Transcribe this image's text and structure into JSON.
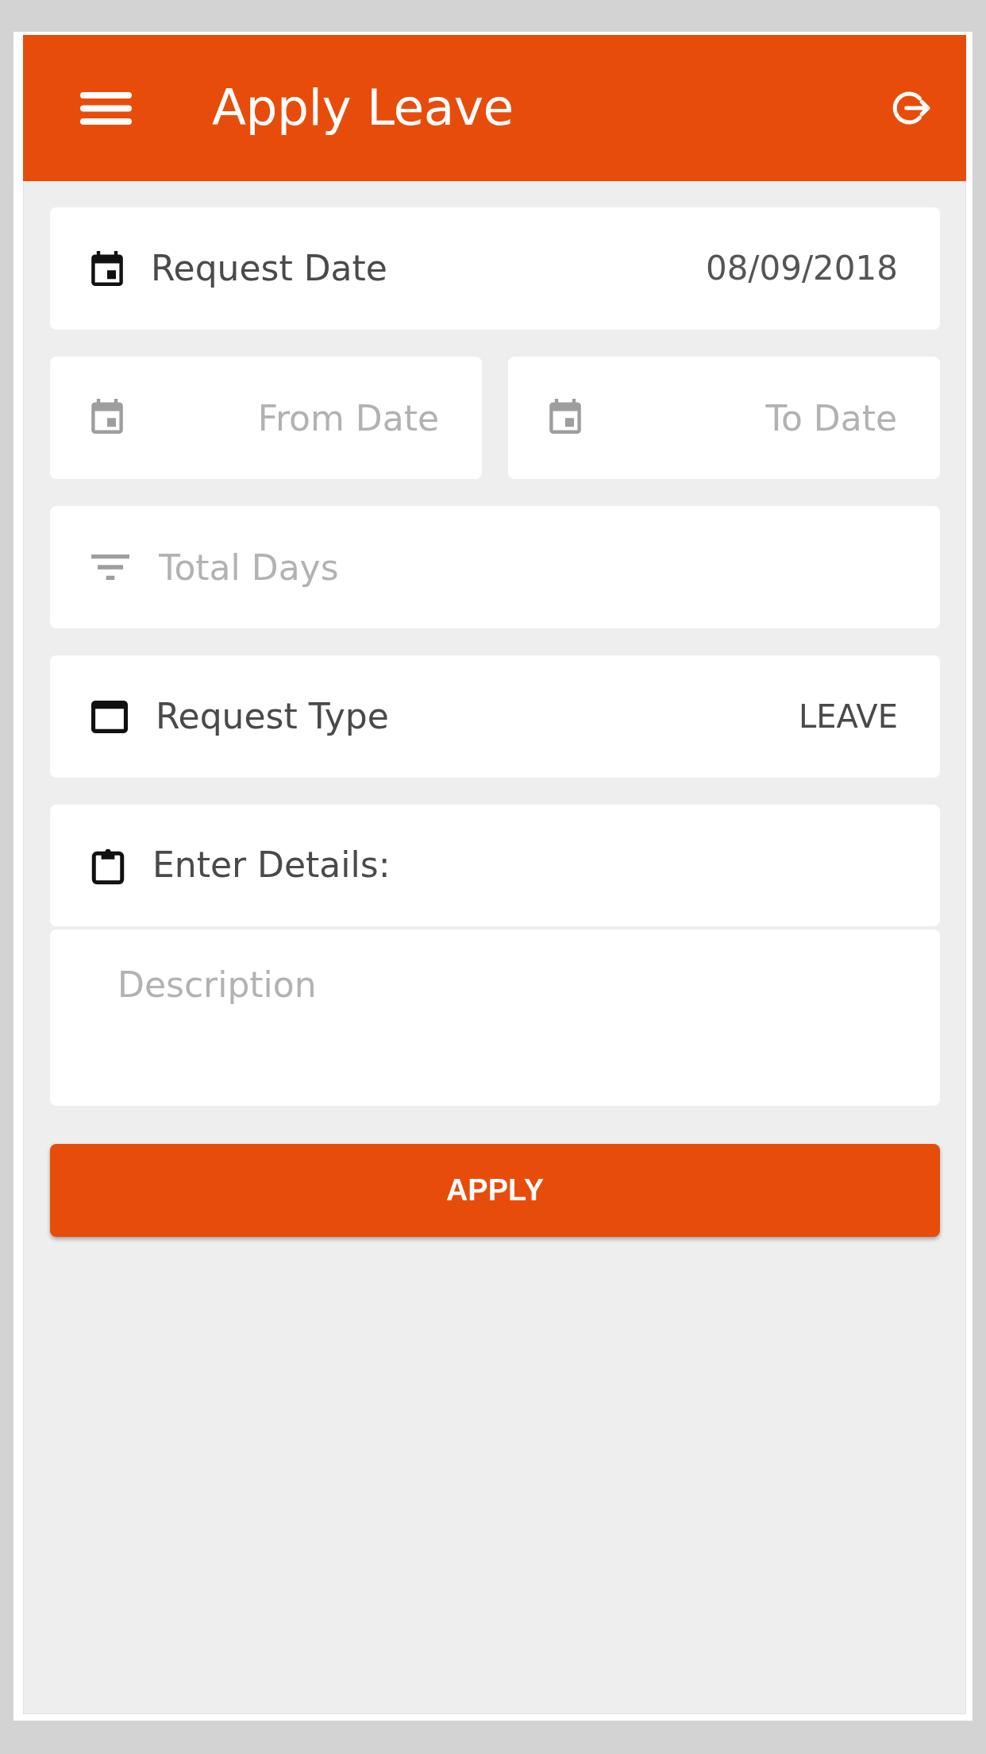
{
  "app_bar": {
    "title": "Apply Leave"
  },
  "request_date": {
    "label": "Request Date",
    "value": "08/09/2018"
  },
  "date_range": [
    {
      "placeholder": "From Date"
    },
    {
      "placeholder": "To Date"
    }
  ],
  "total_days": {
    "placeholder": "Total Days"
  },
  "request_type": {
    "label": "Request Type",
    "value": "LEAVE"
  },
  "details": {
    "label": "Enter Details:",
    "placeholder": "Description"
  },
  "apply_button": {
    "label": "APPLY"
  }
}
